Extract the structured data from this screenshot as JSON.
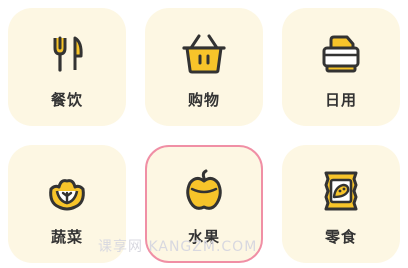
{
  "categories": [
    {
      "label": "餐饮",
      "icon": "fork-knife-icon"
    },
    {
      "label": "购物",
      "icon": "shopping-basket-icon"
    },
    {
      "label": "日用",
      "icon": "daily-goods-icon"
    },
    {
      "label": "蔬菜",
      "icon": "cabbage-icon"
    },
    {
      "label": "水果",
      "icon": "apple-icon",
      "selected": true
    },
    {
      "label": "零食",
      "icon": "snack-bag-icon"
    }
  ],
  "watermark": "课享网 KANGZM.COM",
  "colors": {
    "tile_bg": "#fdf7e3",
    "icon_fill": "#f7c42a",
    "icon_stroke": "#333333",
    "selected_border": "#f08fa5"
  }
}
